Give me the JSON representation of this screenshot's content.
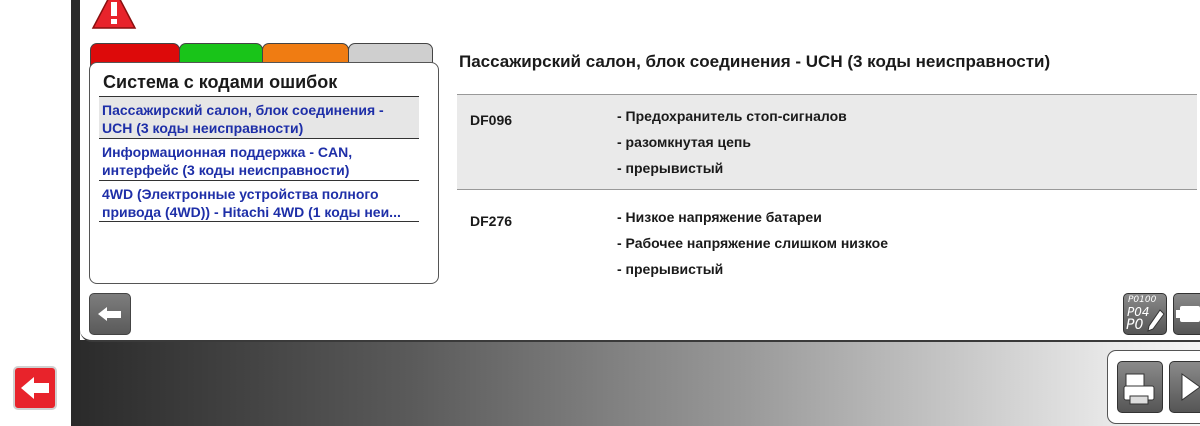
{
  "systems_panel": {
    "title": "Система с кодами ошибок",
    "items": [
      {
        "line1": "Пассажирский салон, блок соединения -",
        "line2": "UCH (3 коды неисправности)",
        "selected": true
      },
      {
        "line1": "Информационная поддержка - CAN,",
        "line2": "интерфейс (3 коды неисправности)",
        "selected": false
      },
      {
        "line1": "4WD (Электронные устройства полного",
        "line2": "привода (4WD)) - Hitachi 4WD (1 коды неи...",
        "selected": false
      }
    ]
  },
  "detail": {
    "title": "Пассажирский салон, блок соединения - UCH (3 коды неисправности)",
    "faults": [
      {
        "code": "DF096",
        "descriptions": [
          "- Предохранитель стоп-сигналов",
          "- разомкнутая цепь",
          "- прерывистый"
        ]
      },
      {
        "code": "DF276",
        "descriptions": [
          "- Низкое напряжение батареи",
          "- Рабочее напряжение слишком низкое",
          "- прерывистый"
        ]
      }
    ]
  },
  "code_button": {
    "line1": "P0100",
    "line2": "P04",
    "line3": "P0"
  },
  "tab_colors": {
    "red": "#dd0a0a",
    "green": "#19c419",
    "orange": "#f07c12",
    "gray": "#cfcfcf"
  },
  "icons": {
    "warning": "warning-triangle-icon",
    "back": "back-arrow-icon",
    "exit": "exit-arrow-icon",
    "print": "printer-icon",
    "next": "play-next-icon",
    "engine": "engine-icon"
  }
}
